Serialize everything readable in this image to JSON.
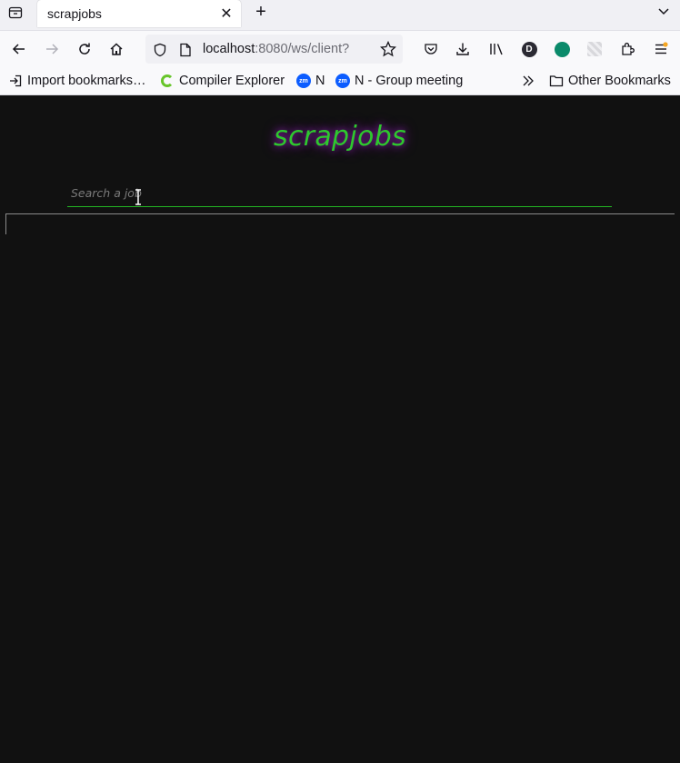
{
  "browser": {
    "tab_title": "scrapjobs",
    "url_host": "localhost",
    "url_rest": ":8080/ws/client?",
    "extension_badge": "off",
    "profile_initial": "D"
  },
  "bookmarks": [
    {
      "label": "Import bookmarks…",
      "icon": "import-icon"
    },
    {
      "label": "Compiler Explorer",
      "icon": "compiler-explorer-icon"
    },
    {
      "label": "N",
      "icon": "zoom-icon"
    },
    {
      "label": "N - Group meeting",
      "icon": "zoom-icon"
    }
  ],
  "bookmarks_other": "Other Bookmarks",
  "page": {
    "title": "scrapjobs",
    "search_placeholder": "Search a job"
  },
  "colors": {
    "page_background": "#111111",
    "title_color": "#2ec82e",
    "title_glow": "#8a1fa8",
    "search_underline": "#23b423"
  }
}
